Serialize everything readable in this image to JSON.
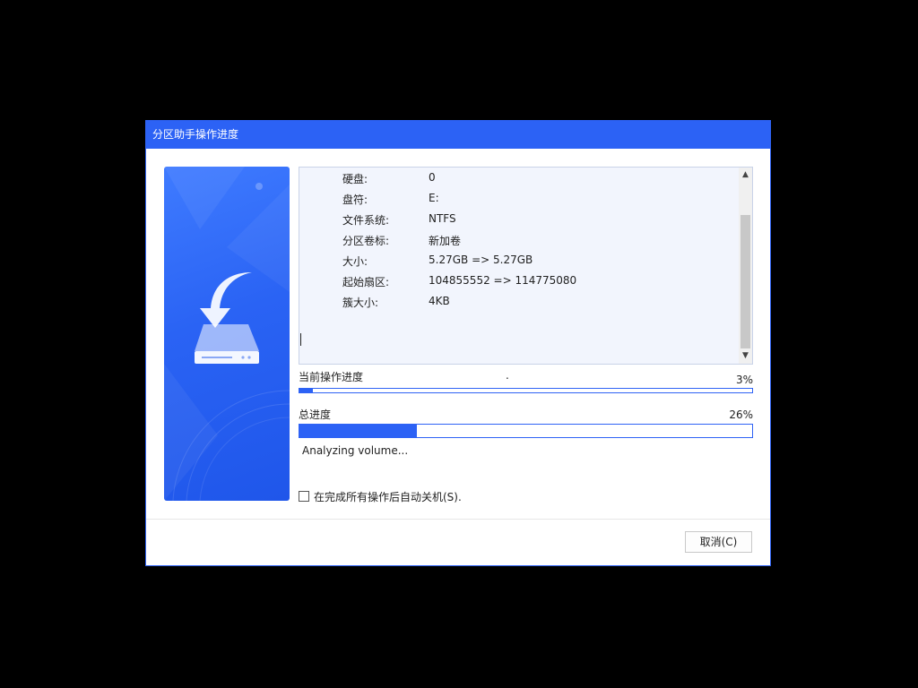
{
  "window": {
    "title": "分区助手操作进度"
  },
  "details": {
    "rows": [
      {
        "key": "硬盘:",
        "value": "0"
      },
      {
        "key": "盘符:",
        "value": "E:"
      },
      {
        "key": "文件系统:",
        "value": "NTFS"
      },
      {
        "key": "分区卷标:",
        "value": "新加卷"
      },
      {
        "key": "大小:",
        "value": "5.27GB => 5.27GB"
      },
      {
        "key": "起始扇区:",
        "value": "104855552 => 114775080"
      },
      {
        "key": "簇大小:",
        "value": "4KB"
      }
    ]
  },
  "current_progress": {
    "label": "当前操作进度",
    "marker": ".",
    "percent_text": "3%",
    "value": 0.03
  },
  "total_progress": {
    "label": "总进度",
    "percent_text": "26%",
    "value": 0.26
  },
  "status_text": "Analyzing volume...",
  "shutdown_checkbox": {
    "label": "在完成所有操作后自动关机(S).",
    "checked": false
  },
  "buttons": {
    "cancel": "取消(C)"
  },
  "colors": {
    "accent": "#2c62f5",
    "background": "#000000"
  },
  "icons": [
    "drive-download-icon",
    "scroll-up-icon",
    "scroll-down-icon"
  ]
}
